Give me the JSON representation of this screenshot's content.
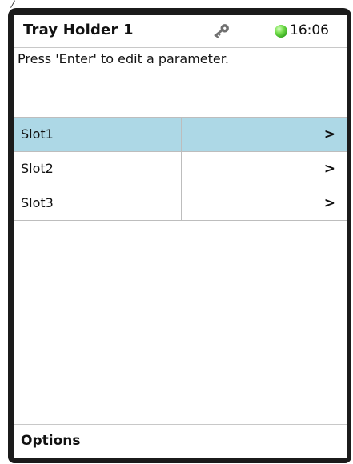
{
  "header": {
    "title": "Tray Holder 1",
    "key_icon": "key-icon",
    "status_led_color": "#3cbf25",
    "time": "16:06"
  },
  "message": "Press 'Enter' to edit a parameter.",
  "list": {
    "selected_index": 0,
    "selected_color": "#add8e6",
    "items": [
      {
        "label": "Slot1",
        "arrow": ">"
      },
      {
        "label": "Slot2",
        "arrow": ">"
      },
      {
        "label": "Slot3",
        "arrow": ">"
      }
    ]
  },
  "footer": {
    "options_label": "Options"
  }
}
